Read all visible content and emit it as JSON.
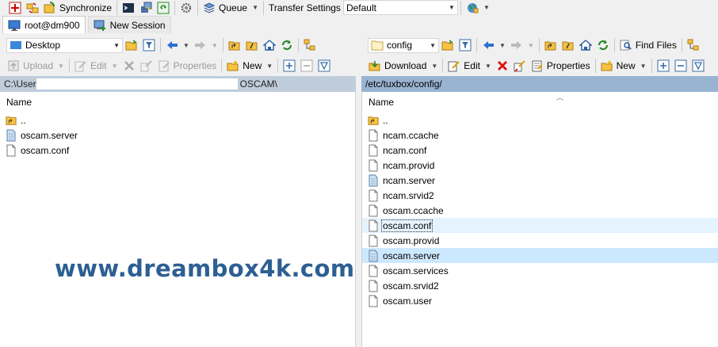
{
  "main_toolbar": {
    "synchronize_label": "Synchronize",
    "queue_label": "Queue",
    "transfer_settings_label": "Transfer Settings",
    "transfer_settings_value": "Default"
  },
  "tabs": [
    {
      "label": "root@dm900"
    },
    {
      "label": "New Session"
    }
  ],
  "left": {
    "location": "Desktop",
    "actions": {
      "upload": "Upload",
      "edit": "Edit",
      "properties": "Properties",
      "new": "New"
    },
    "path_visible_start": "C:\\User",
    "path_visible_end": "OSCAM\\",
    "column_name": "Name",
    "files": [
      {
        "name": "..",
        "icon": "parent-folder-icon"
      },
      {
        "name": "oscam.server",
        "icon": "server-file-icon"
      },
      {
        "name": "oscam.conf",
        "icon": "file-icon"
      }
    ]
  },
  "right": {
    "location": "config",
    "find_files_label": "Find Files",
    "actions": {
      "download": "Download",
      "edit": "Edit",
      "properties": "Properties",
      "new": "New"
    },
    "path": "/etc/tuxbox/config/",
    "column_name": "Name",
    "files": [
      {
        "name": "..",
        "icon": "parent-folder-icon"
      },
      {
        "name": "ncam.ccache",
        "icon": "file-icon"
      },
      {
        "name": "ncam.conf",
        "icon": "file-icon"
      },
      {
        "name": "ncam.provid",
        "icon": "file-icon"
      },
      {
        "name": "ncam.server",
        "icon": "server-file-icon"
      },
      {
        "name": "ncam.srvid2",
        "icon": "file-icon"
      },
      {
        "name": "oscam.ccache",
        "icon": "file-icon"
      },
      {
        "name": "oscam.conf",
        "icon": "file-icon",
        "state": "hover"
      },
      {
        "name": "oscam.provid",
        "icon": "file-icon"
      },
      {
        "name": "oscam.server",
        "icon": "server-file-icon",
        "state": "selected"
      },
      {
        "name": "oscam.services",
        "icon": "file-icon"
      },
      {
        "name": "oscam.srvid2",
        "icon": "file-icon"
      },
      {
        "name": "oscam.user",
        "icon": "file-icon"
      }
    ]
  },
  "watermark": "www.dreambox4k.com",
  "colors": {
    "active_path_bg": "#99b4d1",
    "inactive_path_bg": "#bfcddb",
    "selection_bg": "#cce8ff",
    "hover_bg": "#e5f3ff",
    "watermark": "#2c5f93"
  }
}
